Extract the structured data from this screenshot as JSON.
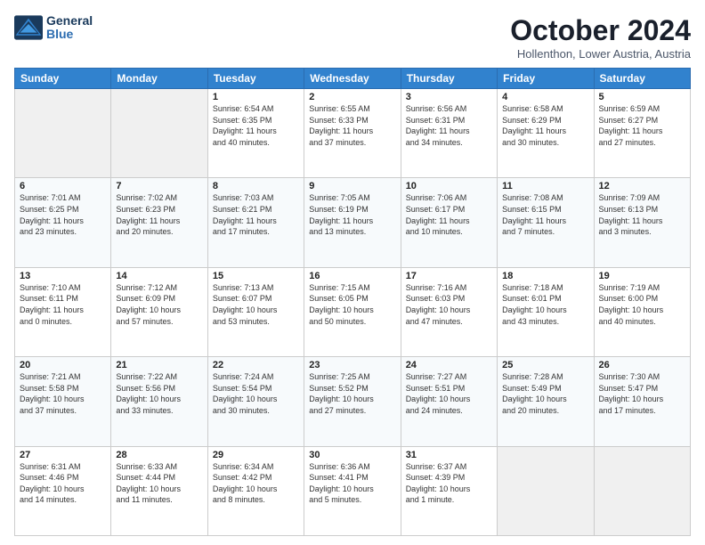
{
  "header": {
    "logo": {
      "line1": "General",
      "line2": "Blue"
    },
    "title": "October 2024",
    "location": "Hollenthon, Lower Austria, Austria"
  },
  "weekdays": [
    "Sunday",
    "Monday",
    "Tuesday",
    "Wednesday",
    "Thursday",
    "Friday",
    "Saturday"
  ],
  "weeks": [
    [
      {
        "day": "",
        "info": ""
      },
      {
        "day": "",
        "info": ""
      },
      {
        "day": "1",
        "info": "Sunrise: 6:54 AM\nSunset: 6:35 PM\nDaylight: 11 hours\nand 40 minutes."
      },
      {
        "day": "2",
        "info": "Sunrise: 6:55 AM\nSunset: 6:33 PM\nDaylight: 11 hours\nand 37 minutes."
      },
      {
        "day": "3",
        "info": "Sunrise: 6:56 AM\nSunset: 6:31 PM\nDaylight: 11 hours\nand 34 minutes."
      },
      {
        "day": "4",
        "info": "Sunrise: 6:58 AM\nSunset: 6:29 PM\nDaylight: 11 hours\nand 30 minutes."
      },
      {
        "day": "5",
        "info": "Sunrise: 6:59 AM\nSunset: 6:27 PM\nDaylight: 11 hours\nand 27 minutes."
      }
    ],
    [
      {
        "day": "6",
        "info": "Sunrise: 7:01 AM\nSunset: 6:25 PM\nDaylight: 11 hours\nand 23 minutes."
      },
      {
        "day": "7",
        "info": "Sunrise: 7:02 AM\nSunset: 6:23 PM\nDaylight: 11 hours\nand 20 minutes."
      },
      {
        "day": "8",
        "info": "Sunrise: 7:03 AM\nSunset: 6:21 PM\nDaylight: 11 hours\nand 17 minutes."
      },
      {
        "day": "9",
        "info": "Sunrise: 7:05 AM\nSunset: 6:19 PM\nDaylight: 11 hours\nand 13 minutes."
      },
      {
        "day": "10",
        "info": "Sunrise: 7:06 AM\nSunset: 6:17 PM\nDaylight: 11 hours\nand 10 minutes."
      },
      {
        "day": "11",
        "info": "Sunrise: 7:08 AM\nSunset: 6:15 PM\nDaylight: 11 hours\nand 7 minutes."
      },
      {
        "day": "12",
        "info": "Sunrise: 7:09 AM\nSunset: 6:13 PM\nDaylight: 11 hours\nand 3 minutes."
      }
    ],
    [
      {
        "day": "13",
        "info": "Sunrise: 7:10 AM\nSunset: 6:11 PM\nDaylight: 11 hours\nand 0 minutes."
      },
      {
        "day": "14",
        "info": "Sunrise: 7:12 AM\nSunset: 6:09 PM\nDaylight: 10 hours\nand 57 minutes."
      },
      {
        "day": "15",
        "info": "Sunrise: 7:13 AM\nSunset: 6:07 PM\nDaylight: 10 hours\nand 53 minutes."
      },
      {
        "day": "16",
        "info": "Sunrise: 7:15 AM\nSunset: 6:05 PM\nDaylight: 10 hours\nand 50 minutes."
      },
      {
        "day": "17",
        "info": "Sunrise: 7:16 AM\nSunset: 6:03 PM\nDaylight: 10 hours\nand 47 minutes."
      },
      {
        "day": "18",
        "info": "Sunrise: 7:18 AM\nSunset: 6:01 PM\nDaylight: 10 hours\nand 43 minutes."
      },
      {
        "day": "19",
        "info": "Sunrise: 7:19 AM\nSunset: 6:00 PM\nDaylight: 10 hours\nand 40 minutes."
      }
    ],
    [
      {
        "day": "20",
        "info": "Sunrise: 7:21 AM\nSunset: 5:58 PM\nDaylight: 10 hours\nand 37 minutes."
      },
      {
        "day": "21",
        "info": "Sunrise: 7:22 AM\nSunset: 5:56 PM\nDaylight: 10 hours\nand 33 minutes."
      },
      {
        "day": "22",
        "info": "Sunrise: 7:24 AM\nSunset: 5:54 PM\nDaylight: 10 hours\nand 30 minutes."
      },
      {
        "day": "23",
        "info": "Sunrise: 7:25 AM\nSunset: 5:52 PM\nDaylight: 10 hours\nand 27 minutes."
      },
      {
        "day": "24",
        "info": "Sunrise: 7:27 AM\nSunset: 5:51 PM\nDaylight: 10 hours\nand 24 minutes."
      },
      {
        "day": "25",
        "info": "Sunrise: 7:28 AM\nSunset: 5:49 PM\nDaylight: 10 hours\nand 20 minutes."
      },
      {
        "day": "26",
        "info": "Sunrise: 7:30 AM\nSunset: 5:47 PM\nDaylight: 10 hours\nand 17 minutes."
      }
    ],
    [
      {
        "day": "27",
        "info": "Sunrise: 6:31 AM\nSunset: 4:46 PM\nDaylight: 10 hours\nand 14 minutes."
      },
      {
        "day": "28",
        "info": "Sunrise: 6:33 AM\nSunset: 4:44 PM\nDaylight: 10 hours\nand 11 minutes."
      },
      {
        "day": "29",
        "info": "Sunrise: 6:34 AM\nSunset: 4:42 PM\nDaylight: 10 hours\nand 8 minutes."
      },
      {
        "day": "30",
        "info": "Sunrise: 6:36 AM\nSunset: 4:41 PM\nDaylight: 10 hours\nand 5 minutes."
      },
      {
        "day": "31",
        "info": "Sunrise: 6:37 AM\nSunset: 4:39 PM\nDaylight: 10 hours\nand 1 minute."
      },
      {
        "day": "",
        "info": ""
      },
      {
        "day": "",
        "info": ""
      }
    ]
  ]
}
